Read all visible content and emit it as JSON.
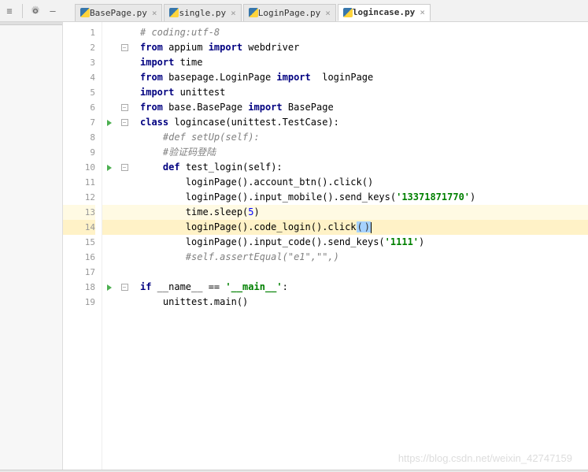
{
  "toolbar": {
    "tabs": [
      {
        "label": "BasePage.py",
        "active": false
      },
      {
        "label": "single.py",
        "active": false
      },
      {
        "label": "LoginPage.py",
        "active": false
      },
      {
        "label": "logincase.py",
        "active": true
      }
    ]
  },
  "code": {
    "lines": [
      {
        "n": 1,
        "fold": "",
        "run": false,
        "hl": "",
        "tokens": [
          {
            "t": "# coding:utf-8",
            "c": "cm"
          }
        ]
      },
      {
        "n": 2,
        "fold": "-",
        "run": false,
        "hl": "",
        "tokens": [
          {
            "t": "from",
            "c": "kw"
          },
          {
            "t": " appium ",
            "c": "id"
          },
          {
            "t": "import",
            "c": "kw"
          },
          {
            "t": " webdriver",
            "c": "id"
          }
        ]
      },
      {
        "n": 3,
        "fold": "",
        "run": false,
        "hl": "",
        "tokens": [
          {
            "t": "import",
            "c": "kw"
          },
          {
            "t": " time",
            "c": "id"
          }
        ]
      },
      {
        "n": 4,
        "fold": "",
        "run": false,
        "hl": "",
        "tokens": [
          {
            "t": "from",
            "c": "kw"
          },
          {
            "t": " basepage.LoginPage ",
            "c": "id"
          },
          {
            "t": "import",
            "c": "kw"
          },
          {
            "t": "  loginPage",
            "c": "id"
          }
        ]
      },
      {
        "n": 5,
        "fold": "",
        "run": false,
        "hl": "",
        "tokens": [
          {
            "t": "import",
            "c": "kw"
          },
          {
            "t": " unittest",
            "c": "id"
          }
        ]
      },
      {
        "n": 6,
        "fold": "-",
        "run": false,
        "hl": "",
        "tokens": [
          {
            "t": "from",
            "c": "kw"
          },
          {
            "t": " base.BasePage ",
            "c": "id"
          },
          {
            "t": "import",
            "c": "kw"
          },
          {
            "t": " BasePage",
            "c": "id"
          }
        ]
      },
      {
        "n": 7,
        "fold": "-",
        "run": true,
        "hl": "",
        "tokens": [
          {
            "t": "class",
            "c": "kw"
          },
          {
            "t": " logincase(unittest.TestCase):",
            "c": "id"
          }
        ]
      },
      {
        "n": 8,
        "fold": "",
        "run": false,
        "hl": "",
        "indent": 1,
        "tokens": [
          {
            "t": "#def setUp(self):",
            "c": "cm"
          }
        ]
      },
      {
        "n": 9,
        "fold": "",
        "run": false,
        "hl": "",
        "indent": 1,
        "tokens": [
          {
            "t": "#验证码登陆",
            "c": "cm"
          }
        ]
      },
      {
        "n": 10,
        "fold": "-",
        "run": true,
        "hl": "",
        "indent": 1,
        "tokens": [
          {
            "t": "def",
            "c": "kw"
          },
          {
            "t": " test_login(self):",
            "c": "id"
          }
        ]
      },
      {
        "n": 11,
        "fold": "",
        "run": false,
        "hl": "",
        "indent": 2,
        "tokens": [
          {
            "t": "loginPage().account_btn().click()",
            "c": "id"
          }
        ]
      },
      {
        "n": 12,
        "fold": "",
        "run": false,
        "hl": "",
        "indent": 2,
        "tokens": [
          {
            "t": "loginPage().input_mobile().send_keys(",
            "c": "id"
          },
          {
            "t": "'13371871770'",
            "c": "str"
          },
          {
            "t": ")",
            "c": "id"
          }
        ]
      },
      {
        "n": 13,
        "fold": "",
        "run": false,
        "hl": "yel",
        "indent": 2,
        "tokens": [
          {
            "t": "time.sleep(",
            "c": "id"
          },
          {
            "t": "5",
            "c": "num"
          },
          {
            "t": ")",
            "c": "id"
          }
        ]
      },
      {
        "n": 14,
        "fold": "",
        "run": false,
        "hl": "cur",
        "indent": 2,
        "tokens": [
          {
            "t": "loginPage().code_login().click",
            "c": "id"
          },
          {
            "t": "(",
            "c": "highlight-paren"
          },
          {
            "t": ")",
            "c": "highlight-paren"
          }
        ],
        "cursor": true
      },
      {
        "n": 15,
        "fold": "",
        "run": false,
        "hl": "",
        "indent": 2,
        "tokens": [
          {
            "t": "loginPage().input_code().send_keys(",
            "c": "id"
          },
          {
            "t": "'1111'",
            "c": "str"
          },
          {
            "t": ")",
            "c": "id"
          }
        ]
      },
      {
        "n": 16,
        "fold": "",
        "run": false,
        "hl": "",
        "indent": 2,
        "tokens": [
          {
            "t": "#self.assertEqual(\"e1\",\"\",)",
            "c": "cm"
          }
        ]
      },
      {
        "n": 17,
        "fold": "",
        "run": false,
        "hl": "",
        "tokens": []
      },
      {
        "n": 18,
        "fold": "-",
        "run": true,
        "hl": "",
        "tokens": [
          {
            "t": "if",
            "c": "kw"
          },
          {
            "t": " __name__ == ",
            "c": "id"
          },
          {
            "t": "'__main__'",
            "c": "str"
          },
          {
            "t": ":",
            "c": "id"
          }
        ]
      },
      {
        "n": 19,
        "fold": "",
        "run": false,
        "hl": "",
        "indent": 1,
        "tokens": [
          {
            "t": "unittest.main()",
            "c": "id"
          }
        ]
      }
    ]
  },
  "watermark": "https://blog.csdn.net/weixin_42747159"
}
